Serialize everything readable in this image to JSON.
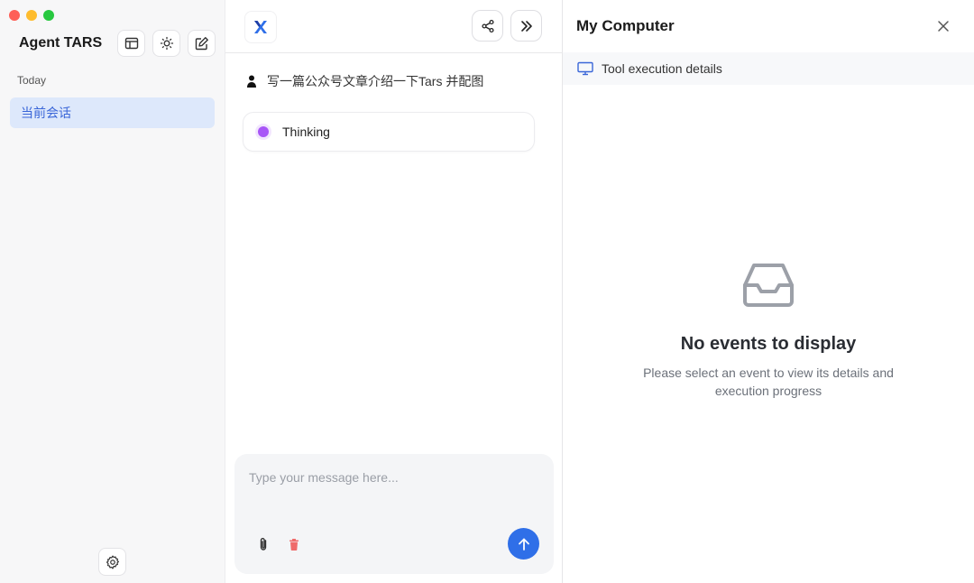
{
  "sidebar": {
    "brand": "Agent TARS",
    "section_label": "Today",
    "sessions": [
      {
        "label": "当前会话"
      }
    ]
  },
  "chat": {
    "user_message": "写一篇公众号文章介绍一下Tars 并配图",
    "status": "Thinking",
    "input": {
      "placeholder": "Type your message here..."
    }
  },
  "panel": {
    "title": "My Computer",
    "subtitle": "Tool execution details",
    "empty_title": "No events to display",
    "empty_description": "Please select an event to view its details and execution progress"
  },
  "icons": {
    "layout": "sidebar-layout-icon",
    "theme": "sun-icon",
    "new_chat": "edit-icon",
    "settings": "gear-icon",
    "share": "share-icon",
    "collapse": "chevrons-right-icon",
    "user": "user-icon",
    "attach": "paperclip-icon",
    "trash": "trash-icon",
    "send": "arrow-up-icon",
    "close": "close-icon",
    "monitor": "monitor-icon",
    "inbox": "inbox-icon"
  },
  "colors": {
    "accent": "#2f6fe8",
    "session_bg": "#dde8fb",
    "session_text": "#3a66d8",
    "thinking_dot": "#a855f7",
    "trash": "#ef6b6b"
  }
}
